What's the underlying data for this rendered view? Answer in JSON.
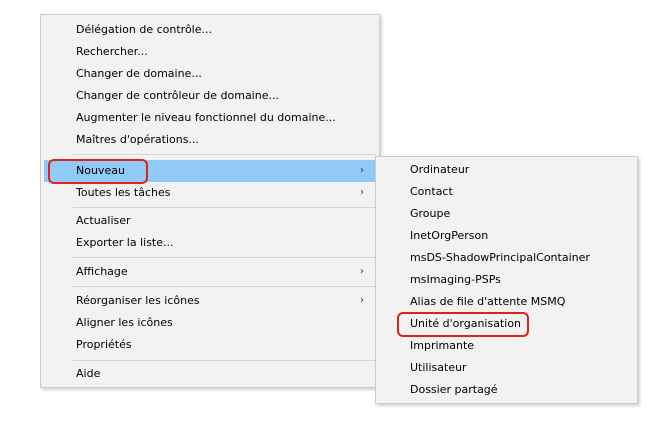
{
  "main_menu": {
    "items": [
      {
        "label": "Délégation de contrôle..."
      },
      {
        "label": "Rechercher..."
      },
      {
        "label": "Changer de domaine..."
      },
      {
        "label": "Changer de contrôleur de domaine..."
      },
      {
        "label": "Augmenter le niveau fonctionnel du domaine..."
      },
      {
        "label": "Maîtres d'opérations..."
      },
      {
        "label": "Nouveau",
        "highlighted": true,
        "submenu_arrow": "›"
      },
      {
        "label": "Toutes les tâches",
        "submenu_arrow": "›"
      },
      {
        "label": "Actualiser"
      },
      {
        "label": "Exporter la liste..."
      },
      {
        "label": "Affichage",
        "submenu_arrow": "›"
      },
      {
        "label": "Réorganiser les icônes",
        "submenu_arrow": "›"
      },
      {
        "label": "Aligner les icônes"
      },
      {
        "label": "Propriétés"
      },
      {
        "label": "Aide"
      }
    ]
  },
  "sub_menu": {
    "items": [
      {
        "label": "Ordinateur"
      },
      {
        "label": "Contact"
      },
      {
        "label": "Groupe"
      },
      {
        "label": "InetOrgPerson"
      },
      {
        "label": "msDS-ShadowPrincipalContainer"
      },
      {
        "label": "msImaging-PSPs"
      },
      {
        "label": "Alias de file d'attente MSMQ"
      },
      {
        "label": "Unité d'organisation",
        "callout": true
      },
      {
        "label": "Imprimante"
      },
      {
        "label": "Utilisateur"
      },
      {
        "label": "Dossier partagé"
      }
    ]
  },
  "colors": {
    "highlight": "#91c9f7",
    "callout": "#e0201a",
    "menu_background": "#f2f2f2"
  }
}
